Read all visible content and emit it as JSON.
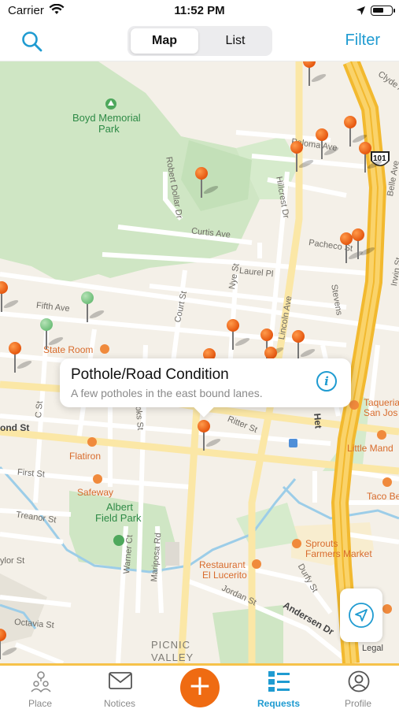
{
  "status_bar": {
    "carrier": "Carrier",
    "time": "11:52 PM"
  },
  "nav": {
    "segments": [
      "Map",
      "List"
    ],
    "selected": "Map",
    "filter_label": "Filter",
    "search_icon": "search-icon"
  },
  "map": {
    "park_labels": [
      "Boyd Memorial",
      "Park",
      "Albert",
      "Field Park"
    ],
    "street_labels": [
      "Robert Dollar Dr",
      "Paloma Ave",
      "Hillcrest Dr",
      "Curtis Ave",
      "Pacheco St",
      "Laurel Pl",
      "Nye St",
      "Lincoln Ave",
      "Fifth Ave",
      "Court St",
      "Stevens",
      "Irwin St",
      "Belle Ave",
      "Clyde A",
      "C St",
      "Brooks St",
      "Ritter St",
      "First St",
      "Treanor St",
      "Warner Ct",
      "Mariposa Rd",
      "Jordan St",
      "Durfy St",
      "Andersen Dr",
      "Octavia St",
      "ylor St",
      "ond St",
      "Het"
    ],
    "poi_labels": [
      "State Room",
      "Flatiron",
      "Safeway",
      "Taqueria",
      "San Jos",
      "Little Mand",
      "Taco Be",
      "Sprouts",
      "Farmers Market",
      "Restaurant",
      "El Lucerito"
    ],
    "area_label": [
      "PICNIC",
      "VALLEY"
    ],
    "highway_shield": "101",
    "legal": "Legal"
  },
  "callout": {
    "title": "Pothole/Road Condition",
    "subtitle": "A few potholes in the east bound lanes.",
    "info_icon": "info-icon"
  },
  "tabs": [
    {
      "label": "Place",
      "icon": "people-map-icon",
      "active": false
    },
    {
      "label": "Notices",
      "icon": "envelope-icon",
      "active": false
    },
    {
      "label": "Requests",
      "icon": "list-icon",
      "active": true
    },
    {
      "label": "Profile",
      "icon": "user-icon",
      "active": false
    }
  ],
  "fab": {
    "label": "+",
    "icon": "plus-icon"
  },
  "colors": {
    "accent": "#1f9bd1",
    "pin": "#ef6b12",
    "pin_closed": "#6fbf7a",
    "tab_border": "#f6c24a"
  }
}
